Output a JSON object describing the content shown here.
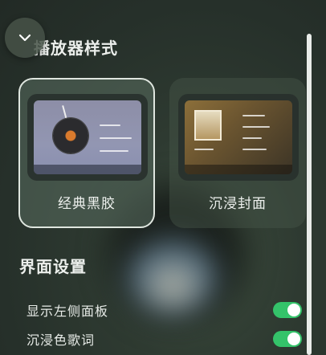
{
  "header": {
    "collapse_icon": "chevron-down-icon",
    "section_title": "播放器样式"
  },
  "player_styles": [
    {
      "label": "经典黑胶",
      "selected": true
    },
    {
      "label": "沉浸封面",
      "selected": false
    }
  ],
  "ui_settings": {
    "title": "界面设置",
    "items": [
      {
        "label": "显示左侧面板",
        "enabled": true
      },
      {
        "label": "沉浸色歌词",
        "enabled": true
      }
    ]
  },
  "colors": {
    "accent_toggle": "#34c36a",
    "selected_border": "#dfe6df"
  }
}
